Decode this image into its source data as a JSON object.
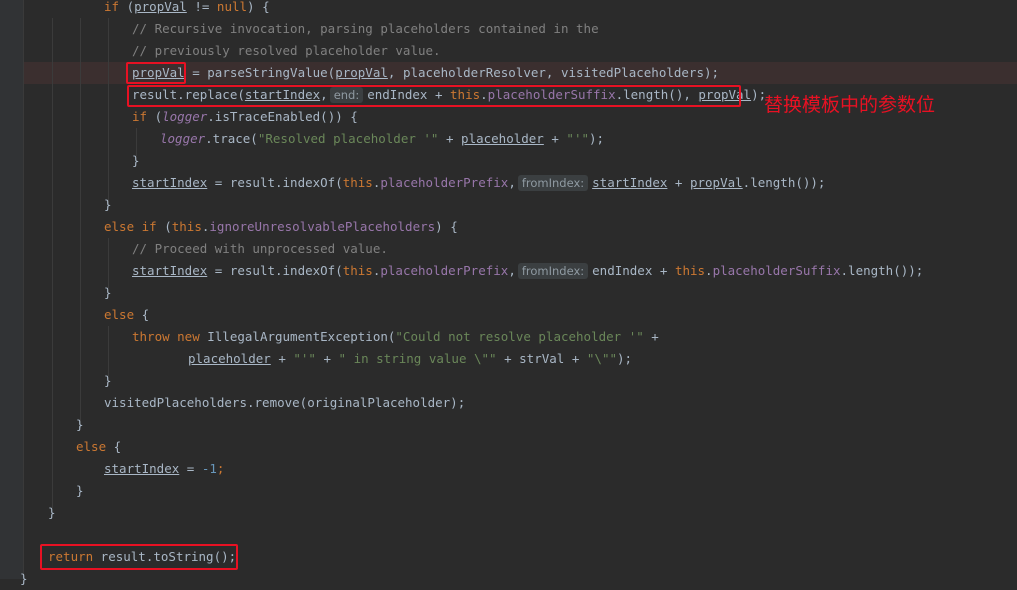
{
  "annotation": "替换模板中的参数位",
  "code": {
    "l1": {
      "a": "if",
      "b": " (",
      "c": "propVal",
      "d": " != ",
      "e": "null",
      "f": ") {"
    },
    "l2": "// Recursive invocation, parsing placeholders contained in the",
    "l3": "// previously resolved placeholder value.",
    "l4": {
      "a": "propVal",
      "b": " = parseStringValue(",
      "c": "propVal",
      "d": ", placeholderResolver, visitedPlaceholders);"
    },
    "l5": {
      "a": "result.replace(",
      "b": "startIndex",
      "c": ",",
      "hint": "end:",
      "d": "endIndex + ",
      "e": "this",
      "f": ".",
      "g": "placeholderSuffix",
      "h": ".length(), ",
      "i": "propVal",
      "j": ");"
    },
    "l6": {
      "a": "if",
      "b": " (",
      "c": "logger",
      "d": ".isTraceEnabled()) {"
    },
    "l7": {
      "a": "logger",
      "b": ".trace(",
      "c": "\"Resolved placeholder '\"",
      "d": " + ",
      "e": "placeholder",
      "f": " + ",
      "g": "\"'\"",
      "h": ");"
    },
    "l8": "}",
    "l9": {
      "a": "startIndex",
      "b": " = result.indexOf(",
      "c": "this",
      "d": ".",
      "e": "placeholderPrefix",
      "f": ",",
      "hint": "fromIndex:",
      "g": "startIndex",
      "h": " + ",
      "i": "propVal",
      "j": ".length());"
    },
    "l10": "}",
    "l11": {
      "a": "else if",
      "b": " (",
      "c": "this",
      "d": ".",
      "e": "ignoreUnresolvablePlaceholders",
      "f": ") {"
    },
    "l12": "// Proceed with unprocessed value.",
    "l13": {
      "a": "startIndex",
      "b": " = result.indexOf(",
      "c": "this",
      "d": ".",
      "e": "placeholderPrefix",
      "f": ",",
      "hint": "fromIndex:",
      "g": "endIndex + ",
      "h": "this",
      "i": ".",
      "j": "placeholderSuffix",
      "k": ".length());"
    },
    "l14": "}",
    "l15": {
      "a": "else",
      "b": " {"
    },
    "l16": {
      "a": "throw new",
      "b": " IllegalArgumentException(",
      "c": "\"Could not resolve placeholder '\"",
      "d": " +"
    },
    "l17": {
      "a": "placeholder",
      "b": " + ",
      "c": "\"'\"",
      "d": " + ",
      "e": "\" in string value \\\"\"",
      "f": " + strVal + ",
      "g": "\"\\\"\"",
      "h": ");"
    },
    "l18": "}",
    "l19": "visitedPlaceholders.remove(originalPlaceholder);",
    "l20": "}",
    "l21": {
      "a": "else",
      "b": " {"
    },
    "l22": {
      "a": "startIndex",
      "b": " = ",
      "c": "-1",
      "d": ";"
    },
    "l23": "}",
    "l24": "}",
    "l25": {
      "a": "return",
      "b": " result.toString();"
    },
    "l26": "}"
  }
}
